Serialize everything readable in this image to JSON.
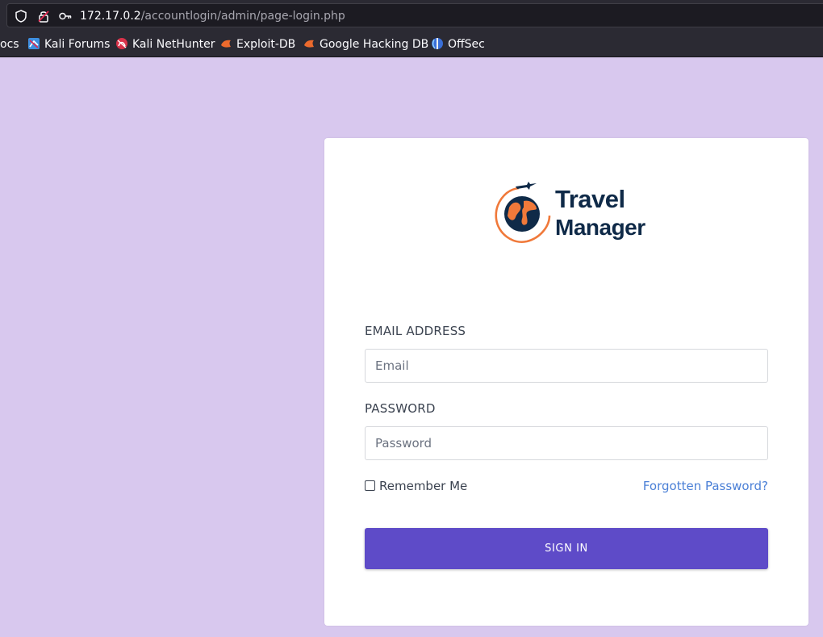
{
  "browser": {
    "url_host": "172.17.0.2",
    "url_path": "/accountlogin/admin/page-login.php",
    "bookmarks": [
      {
        "label": "ocs",
        "icon": "doc-icon"
      },
      {
        "label": "Kali Forums",
        "icon": "kali-forums-icon"
      },
      {
        "label": "Kali NetHunter",
        "icon": "kali-nethunter-icon"
      },
      {
        "label": "Exploit-DB",
        "icon": "exploit-db-icon"
      },
      {
        "label": "Google Hacking DB",
        "icon": "ghdb-icon"
      },
      {
        "label": "OffSec",
        "icon": "offsec-icon"
      }
    ]
  },
  "login": {
    "logo_line1": "Travel",
    "logo_line2": "Manager",
    "email_label": "EMAIL ADDRESS",
    "email_placeholder": "Email",
    "email_value": "",
    "password_label": "PASSWORD",
    "password_placeholder": "Password",
    "password_value": "",
    "remember_label": "Remember Me",
    "remember_checked": false,
    "forgot_label": "Forgotten Password?",
    "signin_label": "SIGN IN"
  },
  "colors": {
    "page_bg": "#d8c8ee",
    "accent": "#5e4bc8",
    "link": "#4a7fd6",
    "logo_navy": "#0f2a48",
    "logo_orange": "#f0793a"
  }
}
